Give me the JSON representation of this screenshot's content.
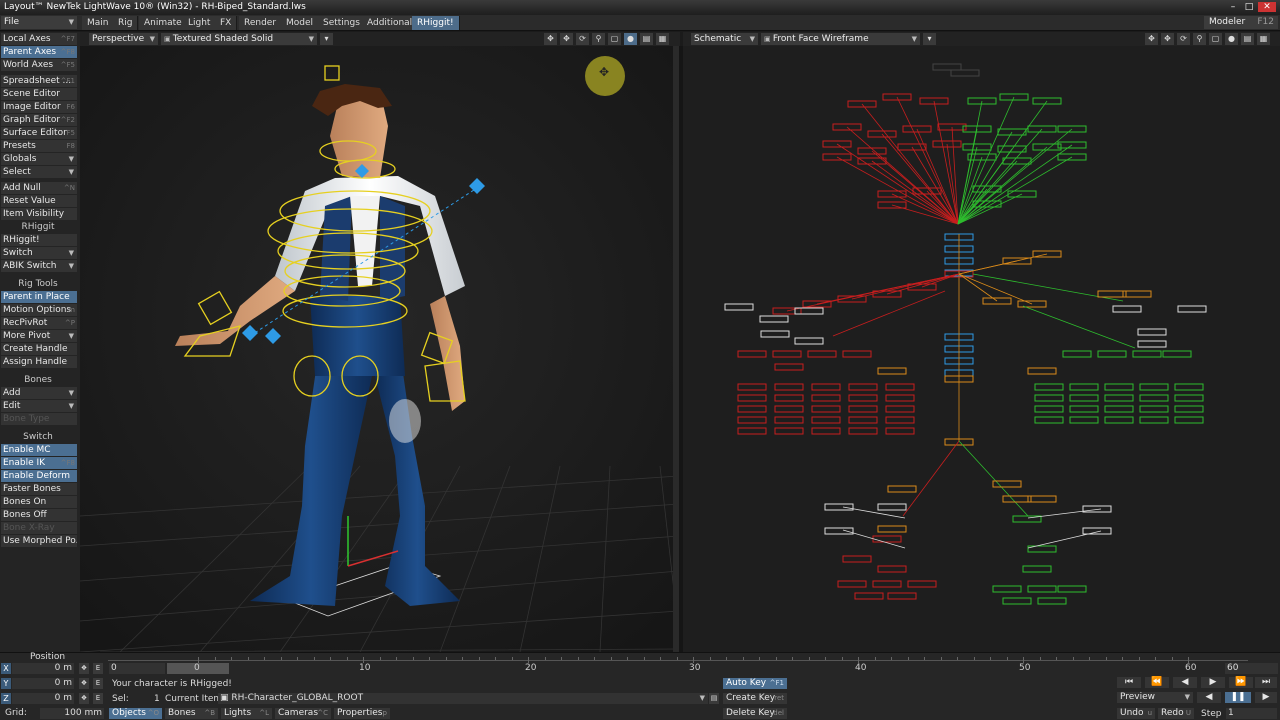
{
  "window": {
    "title": "Layout™ NewTek LightWave 10® (Win32) - RH-Biped_Standard.lws"
  },
  "menu": {
    "file": "File",
    "tabs": [
      "Main",
      "Rig",
      "Animate",
      "Light",
      "FX",
      "Render",
      "Model",
      "Settings",
      "Additional",
      "RHiggit!"
    ],
    "active_tab": "RHiggit!",
    "modeler": "Modeler",
    "modeler_shortcut": "F12"
  },
  "sidebar": {
    "items": [
      {
        "label": "Local Axes",
        "sc": "^F7",
        "hl": false
      },
      {
        "label": "Parent Axes",
        "sc": "^F8",
        "hl": true
      },
      {
        "label": "World Axes",
        "sc": "^F5",
        "hl": false
      },
      {
        "label": "Spreadsheet ...",
        "sc": "^F1",
        "hl": false
      },
      {
        "label": "Scene Editor",
        "sc": "",
        "hl": false
      },
      {
        "label": "Image Editor",
        "sc": "F6",
        "hl": false
      },
      {
        "label": "Graph Editor",
        "sc": "^F2",
        "hl": false
      },
      {
        "label": "Surface Editor",
        "sc": "F5",
        "hl": false
      },
      {
        "label": "Presets",
        "sc": "F8",
        "hl": false
      },
      {
        "label": "Globals",
        "sc": "",
        "arrow": true,
        "hl": false
      },
      {
        "label": "Select",
        "sc": "",
        "arrow": true,
        "hl": false
      },
      {
        "label": "Add Null",
        "sc": "^N",
        "hl": false
      },
      {
        "label": "Reset Value",
        "sc": "",
        "hl": false
      },
      {
        "label": "Item Visibility",
        "sc": "",
        "hl": false
      },
      {
        "label": "RHiggit!",
        "sc": "",
        "hl": false
      },
      {
        "label": "Switch",
        "sc": "",
        "arrow": true,
        "hl": false
      },
      {
        "label": "ABIK Switch",
        "sc": "",
        "arrow": true,
        "hl": false
      },
      {
        "label": "Parent in Place",
        "sc": "",
        "hl": true
      },
      {
        "label": "Motion Options",
        "sc": "m",
        "hl": false
      },
      {
        "label": "RecPivRot",
        "sc": "^P",
        "hl": false
      },
      {
        "label": "More Pivot",
        "sc": "",
        "arrow": true,
        "hl": false
      },
      {
        "label": "Create Handle",
        "sc": "",
        "hl": false
      },
      {
        "label": "Assign Handle",
        "sc": "",
        "hl": false
      },
      {
        "label": "Add",
        "sc": "",
        "arrow": true,
        "hl": false
      },
      {
        "label": "Edit",
        "sc": "",
        "arrow": true,
        "hl": false
      },
      {
        "label": "Bone Type",
        "sc": "",
        "dim": true,
        "hl": false
      },
      {
        "label": "Enable MC",
        "sc": "",
        "hl": true
      },
      {
        "label": "Enable IK",
        "sc": "^F8",
        "hl": true
      },
      {
        "label": "Enable Deform",
        "sc": "",
        "hl": true
      },
      {
        "label": "Faster Bones",
        "sc": "",
        "hl": false
      },
      {
        "label": "Bones On",
        "sc": "",
        "hl": false
      },
      {
        "label": "Bones Off",
        "sc": "",
        "hl": false
      },
      {
        "label": "Bone X-Ray",
        "sc": "",
        "dim": true,
        "hl": false
      },
      {
        "label": "Use Morphed Po...",
        "sc": "",
        "hl": false
      }
    ],
    "headers": [
      "RHiggit",
      "Rig Tools",
      "Bones",
      "Switch"
    ]
  },
  "left_viewport": {
    "view": "Perspective",
    "shading": "Textured Shaded Solid"
  },
  "right_viewport": {
    "view": "Schematic",
    "shading": "Front Face Wireframe",
    "overlay_labels": [
      "L_Leg_FKIK",
      "Foot_Ctl",
      "PolePin",
      "R_Leg_FKIK",
      "Foot_Ctl",
      "PolePin",
      "L_Arm_FKIK",
      "Palm_Ctl",
      "PolePin",
      "R_Arm_FKIK",
      "Palm_Ctl",
      "PolePin",
      "Head_Floor_Ctl",
      "Eyes_LTwr",
      "Ride_Control"
    ]
  },
  "timeline": {
    "position_label": "Position",
    "axes": [
      {
        "axis": "X",
        "value": "0 m"
      },
      {
        "axis": "Y",
        "value": "0 m"
      },
      {
        "axis": "Z",
        "value": "0 m"
      }
    ],
    "grid_label": "Grid:",
    "grid_value": "100 mm",
    "frame_start": "0",
    "ruler_ticks": [
      "0",
      "10",
      "20",
      "30",
      "40",
      "50",
      "60"
    ],
    "end_frame": "60",
    "status": "Your character is RHigged!",
    "sel_label": "Sel:",
    "sel_count": "1",
    "current_item_label": "Current Item",
    "current_item": "RH-Character_GLOBAL_ROOT",
    "tabs": [
      {
        "label": "Objects",
        "sc": "^O",
        "active": true
      },
      {
        "label": "Bones",
        "sc": "^B",
        "active": false
      },
      {
        "label": "Lights",
        "sc": "^L",
        "active": false
      },
      {
        "label": "Cameras",
        "sc": "^C",
        "active": false
      },
      {
        "label": "Properties",
        "sc": "p",
        "active": false
      }
    ],
    "auto_key": "Auto Key",
    "auto_key_sc": "^F1",
    "create_key": "Create Key",
    "create_key_sc": "ret",
    "delete_key": "Delete Key",
    "delete_key_sc": "del",
    "preview": "Preview",
    "undo": "Undo",
    "undo_sc": "u",
    "redo": "Redo",
    "redo_sc": "U",
    "step_label": "Step",
    "step_value": "1"
  },
  "colors": {
    "accent": "#4b6f92",
    "rig_yellow": "#e6d020",
    "bone_blue": "#2e9be6",
    "schematic_red": "#c81e1e",
    "schematic_green": "#2ebd2e",
    "schematic_orange": "#d98a1a"
  }
}
